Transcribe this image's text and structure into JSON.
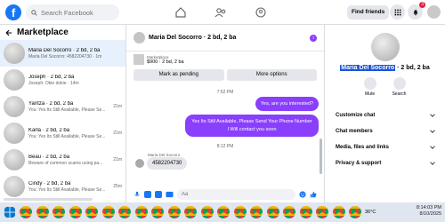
{
  "topbar": {
    "logo": "f",
    "search_placeholder": "Search Facebook",
    "find_friends": "Find friends",
    "notif_count": "3"
  },
  "left": {
    "title": "Marketplace",
    "conversations": [
      {
        "name": "Maria Del Socorro · 2 bd, 2 ba",
        "sub": "Maria Del Socorro: 4582204730 · 1m",
        "time": ""
      },
      {
        "name": "Joseph · 2 bd, 2 ba",
        "sub": "Joseph: Okie dokie · 14m",
        "time": ""
      },
      {
        "name": "Yaritza · 2 bd, 2 ba",
        "sub": "You: Yes Its Still Available, Please Se...",
        "time": "21m"
      },
      {
        "name": "Karla · 2 bd, 2 ba",
        "sub": "You: Yes Its Still Available, Please Se...",
        "time": "21m"
      },
      {
        "name": "Beau · 2 bd, 2 ba",
        "sub": "Beware of common scams using pa...",
        "time": "21m"
      },
      {
        "name": "Cindy · 2 bd, 2 ba",
        "sub": "You: Yes Its Still Available, Please Se...",
        "time": "25m"
      }
    ]
  },
  "chat": {
    "title": "Maria Del Socorro · 2 bd, 2 ba",
    "listing_label": "Marketplace",
    "listing_price": "$900 · 2 bd, 2 ba",
    "mark_pending": "Mark as pending",
    "more_options": "More options",
    "time1": "7:52 PM",
    "msg1": "Yes, are you interested?",
    "msg2": "Yes Its Still Available, Please Send Your Phone Number I Will contact you soon",
    "time2": "8:12 PM",
    "sender_name": "Maria Del Socorro",
    "msg3": "4582204730",
    "composer_placeholder": "Aa"
  },
  "profile": {
    "name_selected": "Maria Del Socorro",
    "name_rest": " · 2 bd, 2 ba",
    "mute": "Mute",
    "search": "Search",
    "menu": [
      "Customize chat",
      "Chat members",
      "Media, files and links",
      "Privacy & support"
    ]
  },
  "taskbar": {
    "weather": "36°C",
    "time": "8:14:03 PM",
    "date": "8/10/2025"
  }
}
